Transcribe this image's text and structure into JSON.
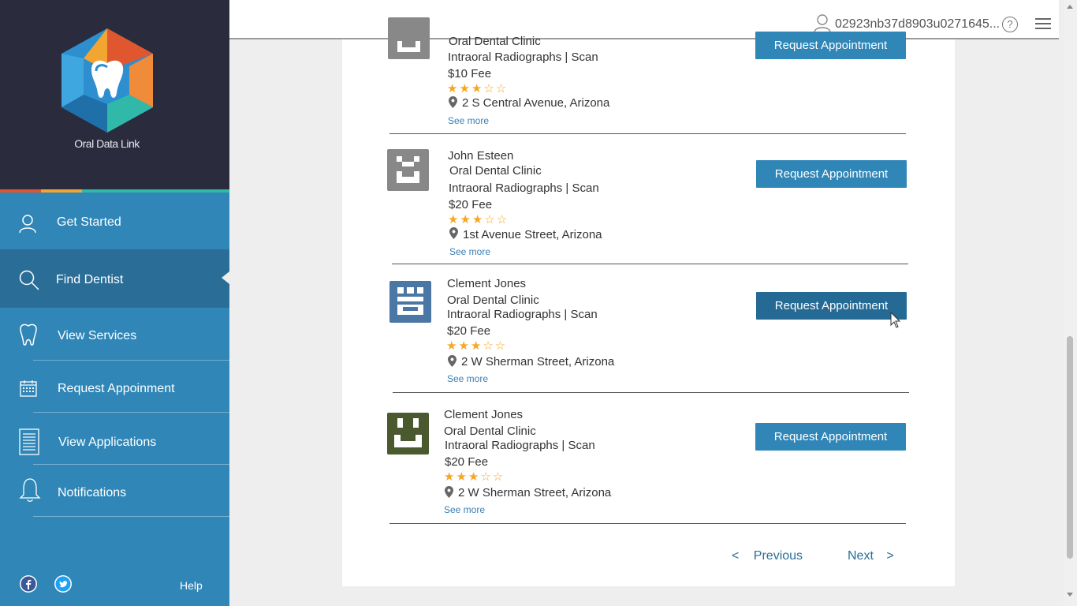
{
  "brand": {
    "name": "Oral Data Link",
    "strip_colors": [
      "#e0562e",
      "#f2a531",
      "#30b9a8"
    ]
  },
  "nav": {
    "items": [
      {
        "label": "Get Started",
        "icon": "user-icon"
      },
      {
        "label": "Find Dentist",
        "icon": "search-icon",
        "active": true
      },
      {
        "label": "View Services",
        "icon": "tooth-icon"
      },
      {
        "label": "Request Appoinment",
        "icon": "calendar-icon"
      },
      {
        "label": "View Applications",
        "icon": "document-icon"
      },
      {
        "label": "Notifications",
        "icon": "bell-icon"
      }
    ],
    "help_label": "Help"
  },
  "topbar": {
    "user_id": "02923nb37d8903u0271645...",
    "help_glyph": "?"
  },
  "dentists": [
    {
      "name": "",
      "clinic": "Oral Dental Clinic",
      "service": "Intraoral Radiographs | Scan",
      "fee": "$10 Fee",
      "rating": 3,
      "stars": "★★★☆☆",
      "address": "2 S Central Avenue, Arizona",
      "see_more": "See more",
      "button": "Request Appointment",
      "avatar_color": "#888888"
    },
    {
      "name": "John Esteen",
      "clinic": "Oral Dental Clinic",
      "service": "Intraoral Radiographs | Scan",
      "fee": "$20 Fee",
      "rating": 3,
      "stars": "★★★☆☆",
      "address": "1st Avenue Street, Arizona",
      "see_more": "See more",
      "button": "Request Appointment",
      "avatar_color": "#888888"
    },
    {
      "name": "Clement Jones",
      "clinic": "Oral Dental Clinic",
      "service": "Intraoral Radiographs | Scan",
      "fee": "$20 Fee",
      "rating": 3,
      "stars": "★★★☆☆",
      "address": "2 W Sherman Street, Arizona",
      "see_more": "See more",
      "button": "Request Appointment",
      "avatar_color": "#4a77a3"
    },
    {
      "name": "Clement Jones",
      "clinic": "Oral Dental Clinic",
      "service": "Intraoral Radiographs | Scan",
      "fee": "$20 Fee",
      "rating": 3,
      "stars": "★★★☆☆",
      "address": "2 W Sherman Street, Arizona",
      "see_more": "See more",
      "button": "Request Appointment",
      "avatar_color": "#4a5a2e"
    }
  ],
  "pager": {
    "previous": "Previous",
    "next": "Next",
    "prev_glyph": "<",
    "next_glyph": ">"
  }
}
